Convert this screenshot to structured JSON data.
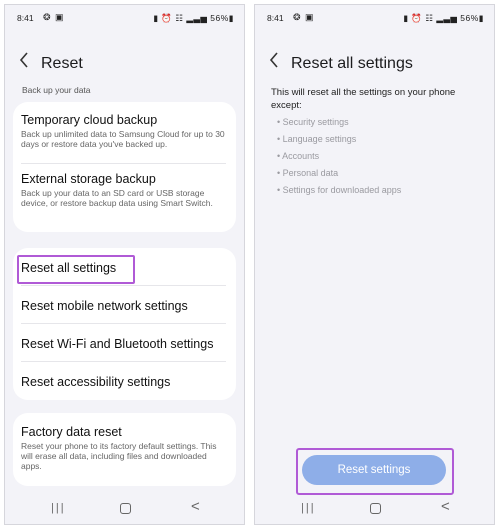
{
  "status_bar": {
    "time": "8:41",
    "notification_icons": "❂ ▣",
    "right": "▮ ⏰ ☷ ▂▃▅ 56%▮"
  },
  "left_screen": {
    "title": "Reset",
    "section_label": "Back up your data",
    "backup_items": [
      {
        "title": "Temporary cloud backup",
        "desc": "Back up unlimited data to Samsung Cloud for up to 30 days or restore data you've backed up."
      },
      {
        "title": "External storage backup",
        "desc": "Back up your data to an SD card or USB storage device, or restore backup data using Smart Switch."
      }
    ],
    "reset_items": [
      "Reset all settings",
      "Reset mobile network settings",
      "Reset Wi-Fi and Bluetooth settings",
      "Reset accessibility settings"
    ],
    "factory": {
      "title": "Factory data reset",
      "desc": "Reset your phone to its factory default settings. This will erase all data, including files and downloaded apps."
    }
  },
  "right_screen": {
    "title": "Reset all settings",
    "intro": "This will reset all the settings on your phone except:",
    "exceptions": [
      "• Security settings",
      "• Language settings",
      "• Accounts",
      "• Personal data",
      "• Settings for downloaded apps"
    ],
    "button_label": "Reset settings"
  },
  "nav_bar": {
    "recent": "|||",
    "back": "<"
  },
  "colors": {
    "accent": "#8eaee8",
    "highlight": "#b05ad6",
    "background": "#f3f3f8"
  }
}
